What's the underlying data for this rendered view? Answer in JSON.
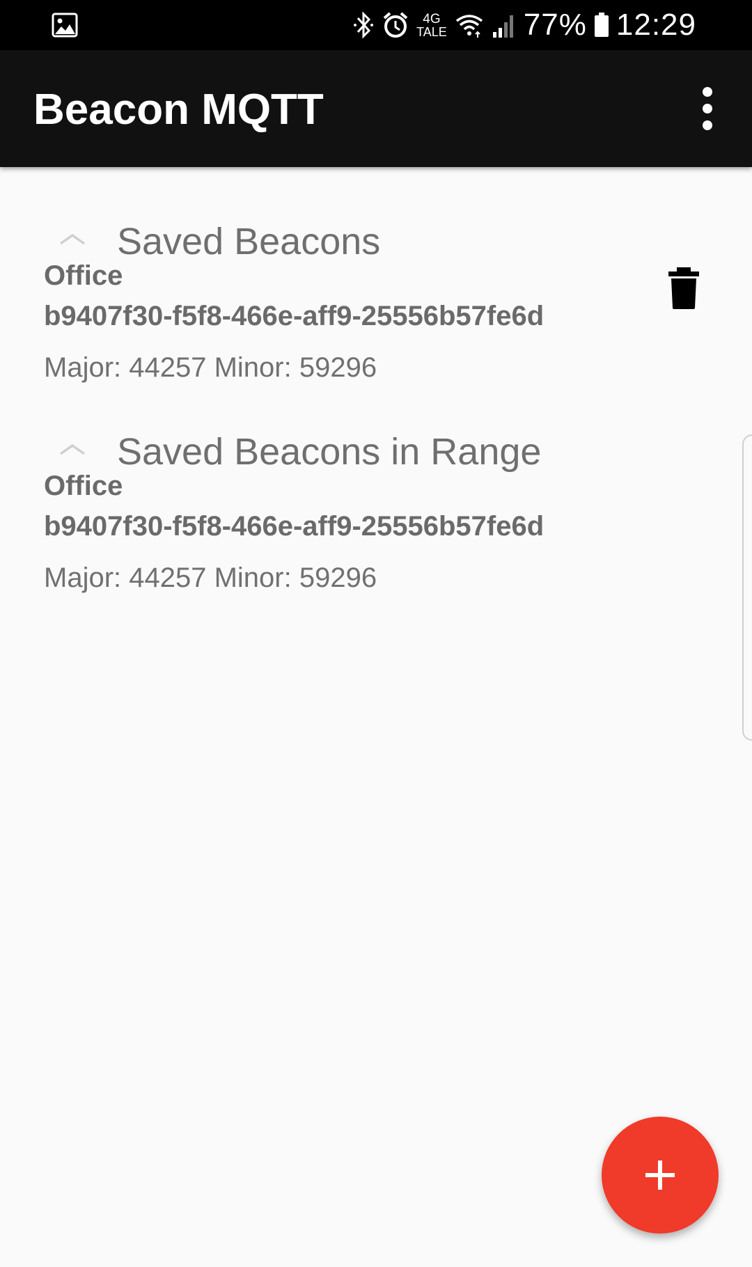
{
  "status_bar": {
    "network_top": "4G",
    "network_bottom": "TALE",
    "battery_percent": "77%",
    "time": "12:29",
    "icons": [
      "image-notification-icon",
      "bluetooth-icon",
      "alarm-icon",
      "wifi-icon",
      "signal-icon",
      "battery-icon"
    ]
  },
  "app_bar": {
    "title": "Beacon MQTT",
    "overflow_icon": "more-vert-icon"
  },
  "sections": [
    {
      "title": "Saved Beacons",
      "chevron_icon": "chevron-up-icon",
      "items": [
        {
          "name": "Office",
          "uuid": "b9407f30-f5f8-466e-aff9-25556b57fe6d",
          "major_minor": "Major: 44257 Minor: 59296",
          "action_icon": "delete-icon"
        }
      ]
    },
    {
      "title": "Saved Beacons in Range",
      "chevron_icon": "chevron-up-icon",
      "items": [
        {
          "name": "Office",
          "uuid": "b9407f30-f5f8-466e-aff9-25556b57fe6d",
          "major_minor": "Major: 44257 Minor: 59296"
        }
      ]
    }
  ],
  "fab": {
    "icon": "add-icon",
    "color": "#f03a2a"
  }
}
